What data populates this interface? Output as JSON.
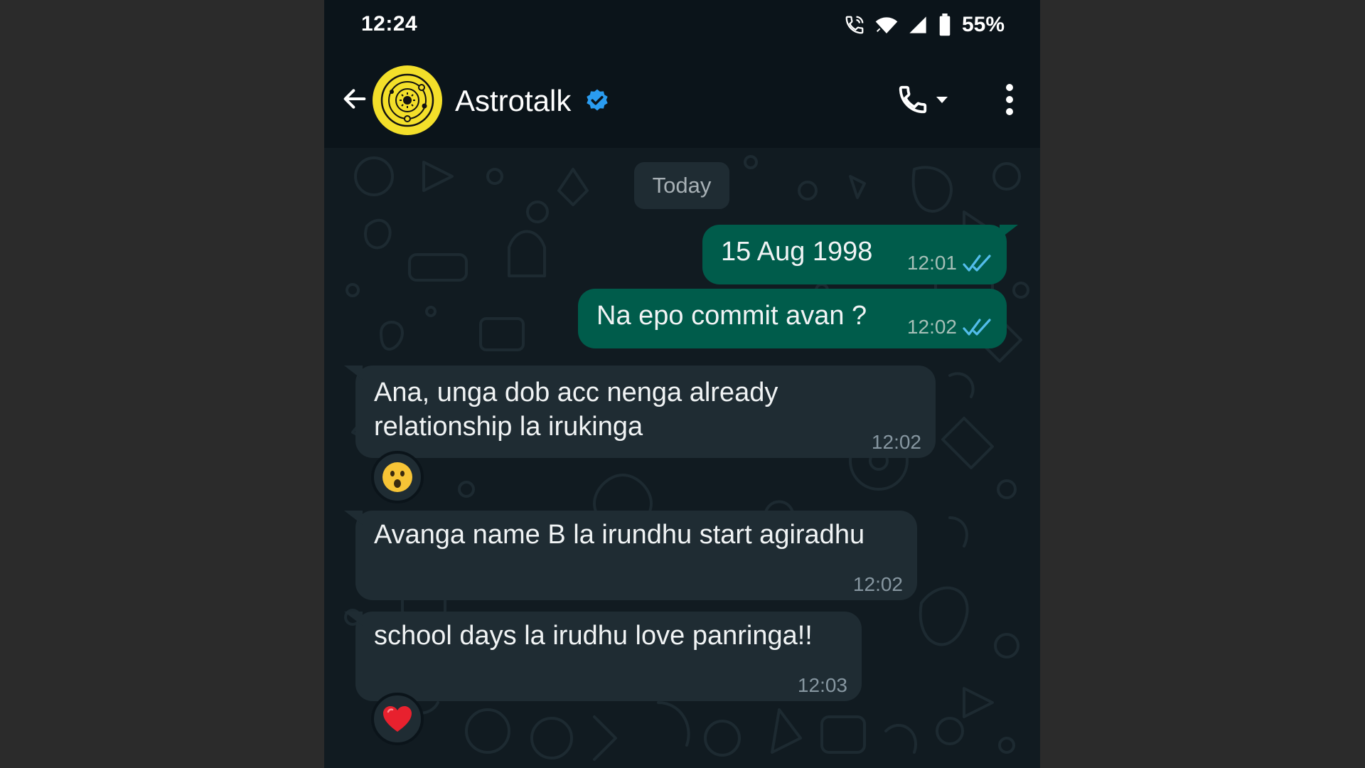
{
  "status_bar": {
    "time": "12:24",
    "battery": "55%",
    "icons": [
      "call-active-icon",
      "wifi-icon",
      "signal-icon",
      "battery-icon"
    ]
  },
  "header": {
    "contact_name": "Astrotalk",
    "verified": true,
    "icons": [
      "back-arrow-icon",
      "avatar-logo",
      "verified-badge-icon",
      "phone-icon",
      "dropdown-icon",
      "more-vert-icon"
    ]
  },
  "chat": {
    "date_chip": "Today",
    "messages": [
      {
        "direction": "out",
        "text": "15 Aug 1998",
        "time": "12:01",
        "status": "read"
      },
      {
        "direction": "out",
        "text": "Na epo commit avan ?",
        "time": "12:02",
        "status": "read"
      },
      {
        "direction": "in",
        "lines": [
          "Ana, unga dob acc nenga already",
          "relationship la irukinga"
        ],
        "time": "12:02",
        "reaction": "😮"
      },
      {
        "direction": "in",
        "text": "Avanga name B la irundhu start agiradhu",
        "time": "12:02"
      },
      {
        "direction": "in",
        "text": "school days la irudhu love panringa!!",
        "time": "12:03",
        "reaction": "❤️"
      }
    ]
  },
  "colors": {
    "background": "#111b21",
    "header": "#0b141a",
    "outgoing_bubble": "#005c4b",
    "incoming_bubble": "#1f2c33",
    "read_ticks": "#53bdeb",
    "verified": "#2a9cf0",
    "avatar": "#f3df2a"
  }
}
